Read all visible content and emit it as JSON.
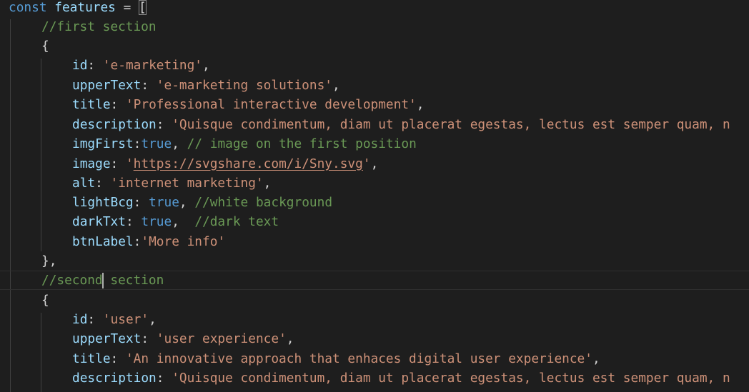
{
  "editor": {
    "colors": {
      "background": "#1e1e1e",
      "keyword": "#569cd6",
      "property": "#9cdcfe",
      "string": "#ce9178",
      "comment": "#6a9955",
      "punctuation": "#d4d4d4"
    },
    "l1": {
      "kw": "const",
      "name": "features",
      "eq": " = ",
      "open": "["
    },
    "l2": {
      "comment": "//first section"
    },
    "l3": {
      "brace": "{"
    },
    "l4": {
      "key": "id",
      "sep": ": ",
      "val": "'e-marketing'",
      "end": ","
    },
    "l5": {
      "key": "upperText",
      "sep": ": ",
      "val": "'e-marketing solutions'",
      "end": ","
    },
    "l6": {
      "key": "title",
      "sep": ": ",
      "val": "'Professional interactive development'",
      "end": ","
    },
    "l7": {
      "key": "description",
      "sep": ": ",
      "val": "'Quisque condimentum, diam ut placerat egestas, lectus est semper quam, n"
    },
    "l8": {
      "key": "imgFirst",
      "sep": ":",
      "val": "true",
      "end": ", ",
      "comment": "// image on the first position"
    },
    "l9": {
      "key": "image",
      "sep": ": ",
      "q1": "'",
      "url": "https://svgshare.com/i/Sny.svg",
      "q2": "'",
      "end": ","
    },
    "l10": {
      "key": "alt",
      "sep": ": ",
      "val": "'internet marketing'",
      "end": ","
    },
    "l11": {
      "key": "lightBcg",
      "sep": ": ",
      "val": "true",
      "end": ", ",
      "comment": "//white background"
    },
    "l12": {
      "key": "darkTxt",
      "sep": ": ",
      "val": "true",
      "end": ",  ",
      "comment": "//dark text"
    },
    "l13": {
      "key": "btnLabel",
      "sep": ":",
      "val": "'More info'"
    },
    "l14": {
      "close": "},"
    },
    "l15": {
      "comment_a": "//second",
      "comment_b": " section"
    },
    "l16": {
      "brace": "{"
    },
    "l17": {
      "key": "id",
      "sep": ": ",
      "val": "'user'",
      "end": ","
    },
    "l18": {
      "key": "upperText",
      "sep": ": ",
      "val": "'user experience'",
      "end": ","
    },
    "l19": {
      "key": "title",
      "sep": ": ",
      "val": "'An innovative approach that enhaces digital user experience'",
      "end": ","
    },
    "l20": {
      "key": "description",
      "sep": ": ",
      "val": "'Quisque condimentum, diam ut placerat egestas, lectus est semper quam, n"
    }
  }
}
